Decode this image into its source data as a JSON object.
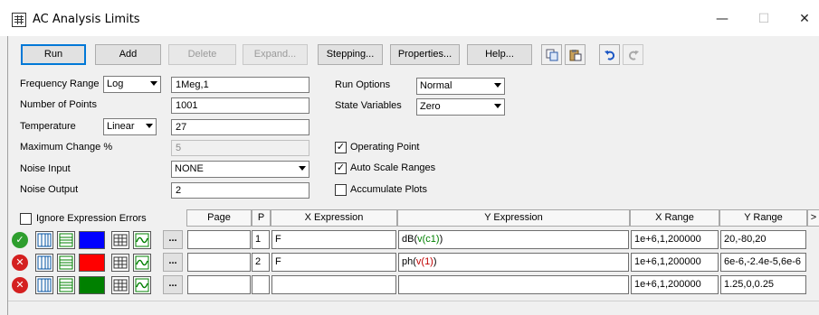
{
  "window": {
    "title": "AC Analysis Limits",
    "icon": "app-grid-icon",
    "controls": {
      "minimize": "—",
      "maximize": "☐",
      "close": "✕"
    }
  },
  "toolbar": {
    "run": "Run",
    "add": "Add",
    "delete": "Delete",
    "expand": "Expand...",
    "stepping": "Stepping...",
    "properties": "Properties...",
    "help": "Help...",
    "icons": [
      "copy-icon",
      "paste-icon",
      "undo-icon",
      "redo-icon"
    ]
  },
  "form": {
    "frequency_range": {
      "label": "Frequency Range",
      "scale": "Log",
      "value": "1Meg,1"
    },
    "number_of_points": {
      "label": "Number of Points",
      "value": "1001"
    },
    "temperature": {
      "label": "Temperature",
      "mode": "Linear",
      "value": "27"
    },
    "maximum_change": {
      "label": "Maximum Change %",
      "value": "5"
    },
    "noise_input": {
      "label": "Noise Input",
      "value": "NONE"
    },
    "noise_output": {
      "label": "Noise Output",
      "value": "2"
    },
    "run_options": {
      "label": "Run Options",
      "value": "Normal"
    },
    "state_variables": {
      "label": "State Variables",
      "value": "Zero"
    },
    "operating_point": {
      "label": "Operating Point",
      "checked": true
    },
    "auto_scale_ranges": {
      "label": "Auto Scale Ranges",
      "checked": true
    },
    "accumulate_plots": {
      "label": "Accumulate Plots",
      "checked": false
    },
    "check_mark": "✓"
  },
  "grid": {
    "ignore_errors": {
      "label": "Ignore Expression Errors",
      "checked": false
    },
    "headers": {
      "page": "Page",
      "p": "P",
      "x_expression": "X Expression",
      "y_expression": "Y Expression",
      "x_range": "X Range",
      "y_range": "Y Range",
      "more": ">"
    },
    "ellipsis": "...",
    "rows": [
      {
        "enabled": true,
        "status_glyph": "✓",
        "color": "#0000ff",
        "page": "",
        "p": "1",
        "x_expr": "F",
        "y_fn": "dB(",
        "y_var": "v(c1)",
        "y_close": ")",
        "x_range": "1e+6,1,200000",
        "y_range": "20,-80,20"
      },
      {
        "enabled": false,
        "status_glyph": "✕",
        "color": "#ff0000",
        "page": "",
        "p": "2",
        "x_expr": "F",
        "y_fn": "ph(",
        "y_var": "v(1)",
        "y_close": ")",
        "x_range": "1e+6,1,200000",
        "y_range": "6e-6,-2.4e-5,6e-6"
      },
      {
        "enabled": false,
        "status_glyph": "✕",
        "color": "#008000",
        "page": "",
        "p": "",
        "x_expr": "",
        "y_fn": "",
        "y_var": "",
        "y_close": "",
        "x_range": "1e+6,1,200000",
        "y_range": "1.25,0,0.25"
      }
    ]
  },
  "colors": {
    "accent": "#0078d7",
    "enabled_status": "#2e9e2e",
    "disabled_status": "#d42020",
    "y_var_green": "#008000",
    "y_var_red": "#c00000"
  }
}
